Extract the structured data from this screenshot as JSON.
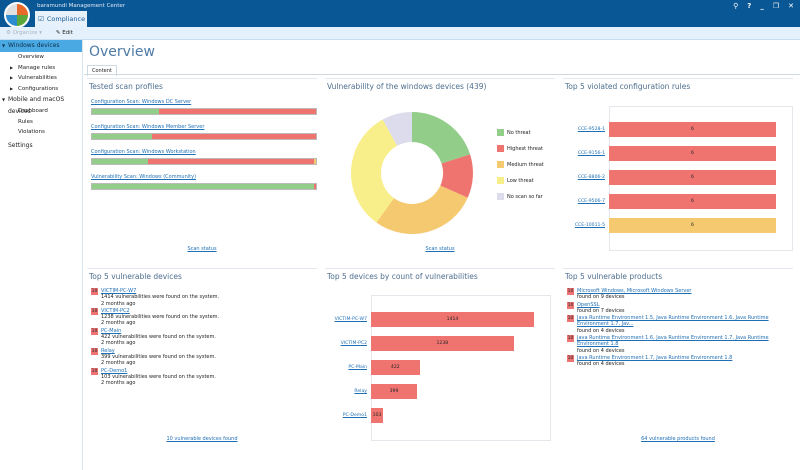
{
  "window": {
    "app_title": "baramundi Management Center",
    "tab_label": "Compliance",
    "controls": [
      "search",
      "help",
      "minimize",
      "restore",
      "close"
    ]
  },
  "toolbar": {
    "organize": "Organize",
    "edit": "Edit"
  },
  "sidebar": {
    "items": [
      {
        "label": "Windows devices",
        "level": 0,
        "selected": true
      },
      {
        "label": "Overview",
        "level": 1
      },
      {
        "label": "Manage rules",
        "level": 1,
        "expandable": true
      },
      {
        "label": "Vulnerabilities",
        "level": 1,
        "expandable": true
      },
      {
        "label": "Configurations",
        "level": 1,
        "expandable": true
      },
      {
        "label": "Mobile and macOS devices",
        "level": 0
      },
      {
        "label": "Dashboard",
        "level": 1
      },
      {
        "label": "Rules",
        "level": 1
      },
      {
        "label": "Violations",
        "level": 1
      },
      {
        "label": "Settings",
        "level": 0
      }
    ]
  },
  "page": {
    "title": "Overview",
    "tab": "Content"
  },
  "colors": {
    "no_threat": "#93cd8a",
    "highest": "#ef7470",
    "medium": "#f5c96f",
    "low": "#f8ee8a",
    "no_scan": "#dcdcec"
  },
  "scan_profiles": {
    "title": "Tested scan profiles",
    "footer": "Scan status",
    "items": [
      {
        "name": "Configuration Scan: Windows DC Server",
        "no_threat": 30,
        "highest": 70,
        "medium": 0
      },
      {
        "name": "Configuration Scan: Windows Member Server",
        "no_threat": 27,
        "highest": 73,
        "medium": 0
      },
      {
        "name": "Configuration Scan: Windows Workstation",
        "no_threat": 25,
        "highest": 74,
        "medium": 1
      },
      {
        "name": "Vulnerability Scan: Windows (Community)",
        "no_threat": 99,
        "highest": 1,
        "medium": 0
      }
    ]
  },
  "chart_data": [
    {
      "type": "pie",
      "title": "Vulnerability of the windows devices (439)",
      "legend": "right",
      "labels": [
        "No threat",
        "Highest threat",
        "Medium threat",
        "Low threat",
        "No scan so far"
      ],
      "values": [
        88,
        51,
        124,
        141,
        35
      ]
    },
    {
      "type": "bar",
      "orientation": "horizontal",
      "title": "Top 5 violated configuration rules",
      "categories": [
        "CCE-9528-1",
        "CCE-9156-1",
        "CCE-8806-2",
        "CCE-9506-7",
        "CCE-10011-5"
      ],
      "values": [
        6,
        6,
        6,
        6,
        6
      ],
      "severity": [
        "highest",
        "highest",
        "highest",
        "highest",
        "medium"
      ]
    },
    {
      "type": "bar",
      "orientation": "horizontal",
      "title": "Top 5 devices by count of vulnerabilities",
      "categories": [
        "VICTIM-PC-W7",
        "VICTIM-PC2",
        "PC-Main",
        "Relay",
        "PC-Demo1"
      ],
      "values": [
        1414,
        1238,
        422,
        399,
        103
      ]
    }
  ],
  "pie_footer": "Scan status",
  "devices": {
    "title": "Top 5 vulnerable devices",
    "footer": "10 vulnerable devices found",
    "items": [
      {
        "score": "10",
        "name": "VICTIM-PC-W7",
        "desc": "1414 vulnerabilities were found on the system.",
        "time": "2 months ago"
      },
      {
        "score": "10",
        "name": "VICTIM-PC2",
        "desc": "1238 vulnerabilities were found on the system.",
        "time": "2 months ago"
      },
      {
        "score": "10",
        "name": "PC-Main",
        "desc": "422 vulnerabilities were found on the system.",
        "time": "2 months ago"
      },
      {
        "score": "10",
        "name": "Relay",
        "desc": "399 vulnerabilities were found on the system.",
        "time": "2 months ago"
      },
      {
        "score": "10",
        "name": "PC-Demo1",
        "desc": "103 vulnerabilities were found on the system.",
        "time": "2 months ago"
      }
    ]
  },
  "products": {
    "title": "Top 5 vulnerable products",
    "footer": "64 vulnerable products found",
    "items": [
      {
        "score": "10",
        "name": "Microsoft Windows, Microsoft Windows Server",
        "desc": "found on 9 devices"
      },
      {
        "score": "10",
        "name": "OpenSSL",
        "desc": "found on 7 devices"
      },
      {
        "score": "10",
        "name": "Java Runtime Environment 1.5, Java Runtime Environment 1.6, Java Runtime Environment 1.7, Jav...",
        "desc": "found on 4 devices"
      },
      {
        "score": "10",
        "name": "Java Runtime Environment 1.6, Java Runtime Environment 1.7, Java Runtime Environment 1.8",
        "desc": "found on 4 devices"
      },
      {
        "score": "10",
        "name": "Java Runtime Environment 1.7, Java Runtime Environment 1.8",
        "desc": "found on 4 devices"
      }
    ]
  }
}
